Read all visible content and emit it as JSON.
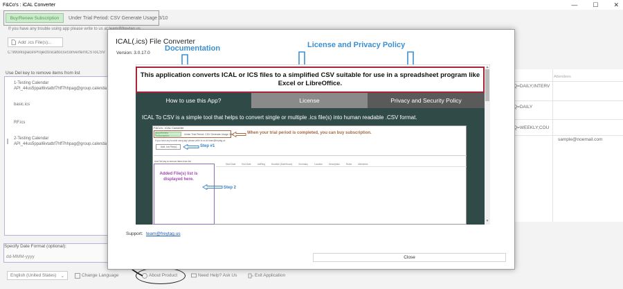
{
  "window": {
    "title": "F&Co's : iCAL Converter",
    "minimize": "—",
    "maximize": "☐",
    "close": "✕"
  },
  "main": {
    "buy_button": "Buy/Renew Subscription",
    "trial_text": "Under Trial Period: CSV Generate Usage 3/10",
    "trouble_text": "If you have any trouble using app please write to us at team@freytag.us",
    "add_button": "Add .ics File(s)...",
    "path_text": "C:\\Workspace\\Projects\\icaltocsvconverter\\ICSToCSV",
    "list_label": "Use Del key to remove items from list",
    "list_items": [
      "1-Testing Calendar",
      "API_44us5ppal6ivtatbf7hff7hhpag@group.calendar",
      "basic.ics",
      "RF.ics",
      "2-Testing Calendar",
      "API_44us5ppal6ivtatbf7hff7hhpag@group.calendar"
    ],
    "grid_header": "Attendees",
    "grid_cells": [
      "Q=DAILY;INTERV",
      "Q=DAILY",
      "Q=WEEKLY;COU"
    ],
    "grid_attendee": "sample@noemail.com",
    "date_label": "Specify Date Format (optional):",
    "date_value": "dd-MMM-yyyy",
    "language": "English (United States)",
    "change_language": "Change Language",
    "about_product": "About Product",
    "need_help": "Need Help? Ask Us",
    "exit": "Exit Application"
  },
  "modal": {
    "title": "ICAL(.ics) File Converter",
    "version": "Version: 3.0.17.0",
    "annotations": {
      "documentation": "Documentation",
      "license_privacy": "License and Privacy Policy"
    },
    "banner": "This application converts ICAL or ICS files to a simplified CSV suitable for use in a spreadsheet program like Excel or LibreOffice.",
    "tabs": [
      "How to use this App?",
      "License",
      "Privacy and Security Policy"
    ],
    "intro": "ICAL To CSV is a simple tool that helps to convert single or multiple .ics file(s) into human readable .CSV format.",
    "mini": {
      "title": "F&Co's : iCAL Converter",
      "buy": "Buy/Renew Subscription",
      "trial": "Under Trial Period: CSV Generate Usage 3/10",
      "trouble": "If you have any trouble using app please write to us at team@freytag.us",
      "add": "Add .ics File(s)...",
      "list_label": "Use Del key to remove items from list",
      "note_trial": "When your trial period is completed, you can buy subscription.",
      "step1": "Step #1",
      "step2": "Step 2",
      "added": "Added File(s) list is displayed here.",
      "grid_headers": [
        "Start Date",
        "End Date",
        "UidRing",
        "Duration (DateHours)",
        "Summary",
        "Location",
        "Description",
        "Rules",
        "Attendees"
      ]
    },
    "support_label": "Support:",
    "support_email": "team@freytag.us",
    "close": "Close"
  },
  "colors": {
    "accent": "#3a8fd2",
    "banner_border": "#a8233a",
    "tab_dark": "#2f4a47"
  }
}
